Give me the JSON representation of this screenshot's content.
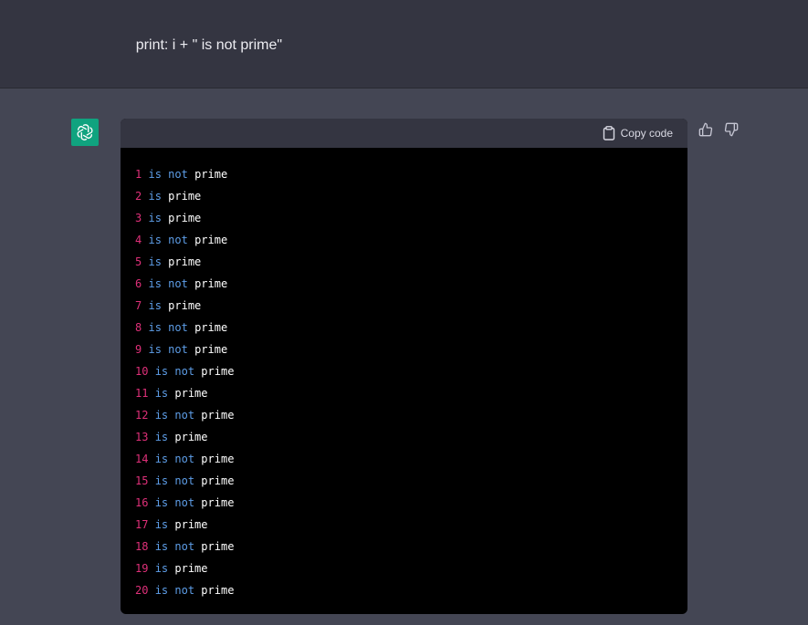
{
  "previous_message": {
    "code_lines": [
      "    print: i + \" is not prime\"",
      "  }",
      "}"
    ]
  },
  "assistant": {
    "avatar_icon": "openai-logo-icon",
    "avatar_color": "#10a37f",
    "code_block": {
      "copy_label": "Copy code",
      "lines": [
        {
          "num": "1",
          "is": "is",
          "not": "not",
          "word": "prime"
        },
        {
          "num": "2",
          "is": "is",
          "not": "",
          "word": "prime"
        },
        {
          "num": "3",
          "is": "is",
          "not": "",
          "word": "prime"
        },
        {
          "num": "4",
          "is": "is",
          "not": "not",
          "word": "prime"
        },
        {
          "num": "5",
          "is": "is",
          "not": "",
          "word": "prime"
        },
        {
          "num": "6",
          "is": "is",
          "not": "not",
          "word": "prime"
        },
        {
          "num": "7",
          "is": "is",
          "not": "",
          "word": "prime"
        },
        {
          "num": "8",
          "is": "is",
          "not": "not",
          "word": "prime"
        },
        {
          "num": "9",
          "is": "is",
          "not": "not",
          "word": "prime"
        },
        {
          "num": "10",
          "is": "is",
          "not": "not",
          "word": "prime"
        },
        {
          "num": "11",
          "is": "is",
          "not": "",
          "word": "prime"
        },
        {
          "num": "12",
          "is": "is",
          "not": "not",
          "word": "prime"
        },
        {
          "num": "13",
          "is": "is",
          "not": "",
          "word": "prime"
        },
        {
          "num": "14",
          "is": "is",
          "not": "not",
          "word": "prime"
        },
        {
          "num": "15",
          "is": "is",
          "not": "not",
          "word": "prime"
        },
        {
          "num": "16",
          "is": "is",
          "not": "not",
          "word": "prime"
        },
        {
          "num": "17",
          "is": "is",
          "not": "",
          "word": "prime"
        },
        {
          "num": "18",
          "is": "is",
          "not": "not",
          "word": "prime"
        },
        {
          "num": "19",
          "is": "is",
          "not": "",
          "word": "prime"
        },
        {
          "num": "20",
          "is": "is",
          "not": "not",
          "word": "prime"
        }
      ]
    },
    "feedback": {
      "thumbs_up_icon": "thumbs-up-icon",
      "thumbs_down_icon": "thumbs-down-icon"
    }
  }
}
